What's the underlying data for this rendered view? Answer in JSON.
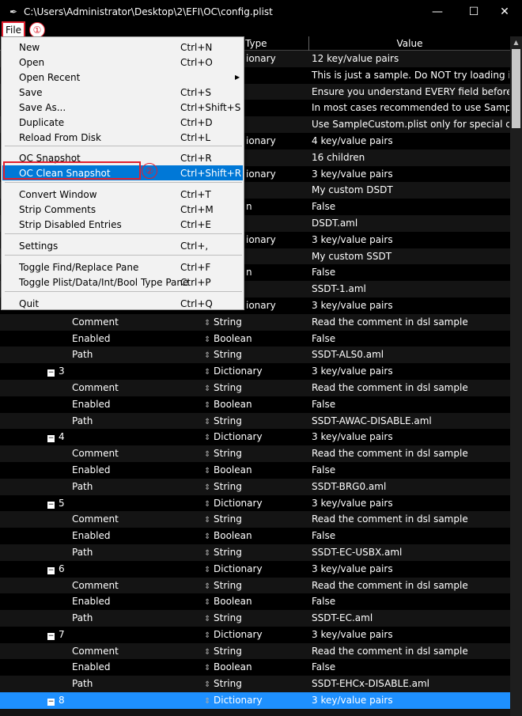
{
  "window": {
    "title": "C:\\Users\\Administrator\\Desktop\\2\\EFI\\OC\\config.plist",
    "minimize_icon": "minimize-icon",
    "maximize_icon": "maximize-icon",
    "close_icon": "close-icon"
  },
  "menubar": {
    "file_label": "File"
  },
  "annotations": {
    "step1": "①",
    "step2": "②",
    "highlight_color": "#e0202e"
  },
  "columns": {
    "type": "Type",
    "value": "Value"
  },
  "menu": {
    "items": [
      {
        "label": "New",
        "shortcut": "Ctrl+N"
      },
      {
        "label": "Open",
        "shortcut": "Ctrl+O"
      },
      {
        "label": "Open Recent",
        "shortcut": "",
        "submenu": true
      },
      {
        "label": "Save",
        "shortcut": "Ctrl+S"
      },
      {
        "label": "Save As...",
        "shortcut": "Ctrl+Shift+S"
      },
      {
        "label": "Duplicate",
        "shortcut": "Ctrl+D"
      },
      {
        "label": "Reload From Disk",
        "shortcut": "Ctrl+L"
      },
      {
        "label": "OC Snapshot",
        "shortcut": "Ctrl+R"
      },
      {
        "label": "OC Clean Snapshot",
        "shortcut": "Ctrl+Shift+R"
      },
      {
        "label": "Convert Window",
        "shortcut": "Ctrl+T"
      },
      {
        "label": "Strip Comments",
        "shortcut": "Ctrl+M"
      },
      {
        "label": "Strip Disabled Entries",
        "shortcut": "Ctrl+E"
      },
      {
        "label": "Settings",
        "shortcut": "Ctrl+,"
      },
      {
        "label": "Toggle Find/Replace Pane",
        "shortcut": "Ctrl+F"
      },
      {
        "label": "Toggle Plist/Data/Int/Bool Type Pane",
        "shortcut": "Ctrl+P"
      },
      {
        "label": "Quit",
        "shortcut": "Ctrl+Q"
      }
    ]
  },
  "rows": [
    {
      "key": "",
      "type": "ionary",
      "value": "12 key/value pairs"
    },
    {
      "key": "",
      "type": "",
      "value": "This is just a sample. Do NOT try loading it."
    },
    {
      "key": "",
      "type": "",
      "value": "Ensure you understand EVERY field before boc"
    },
    {
      "key": "",
      "type": "",
      "value": "In most cases recommended to use Sample.pli"
    },
    {
      "key": "",
      "type": "",
      "value": "Use SampleCustom.plist only for special cases."
    },
    {
      "key": "",
      "type": "ionary",
      "value": "4 key/value pairs"
    },
    {
      "key": "",
      "type": "",
      "value": "16 children"
    },
    {
      "key": "",
      "type": "ionary",
      "value": "3 key/value pairs"
    },
    {
      "key": "",
      "type": "",
      "value": "My custom DSDT"
    },
    {
      "key": "",
      "type": "n",
      "value": "False"
    },
    {
      "key": "",
      "type": "",
      "value": "DSDT.aml"
    },
    {
      "key": "",
      "type": "ionary",
      "value": "3 key/value pairs"
    },
    {
      "key": "",
      "type": "",
      "value": "My custom SSDT"
    },
    {
      "key": "",
      "type": "n",
      "value": "False"
    },
    {
      "key": "",
      "type": "",
      "value": "SSDT-1.aml"
    },
    {
      "key": "",
      "type": "ionary",
      "value": "3 key/value pairs"
    },
    {
      "key": "Comment",
      "type": "String",
      "value": "Read the comment in dsl sample"
    },
    {
      "key": "Enabled",
      "type": "Boolean",
      "value": "False"
    },
    {
      "key": "Path",
      "type": "String",
      "value": "SSDT-ALS0.aml"
    },
    {
      "key": "3",
      "type": "Dictionary",
      "value": "3 key/value pairs",
      "expander": "−"
    },
    {
      "key": "Comment",
      "type": "String",
      "value": "Read the comment in dsl sample"
    },
    {
      "key": "Enabled",
      "type": "Boolean",
      "value": "False"
    },
    {
      "key": "Path",
      "type": "String",
      "value": "SSDT-AWAC-DISABLE.aml"
    },
    {
      "key": "4",
      "type": "Dictionary",
      "value": "3 key/value pairs",
      "expander": "−"
    },
    {
      "key": "Comment",
      "type": "String",
      "value": "Read the comment in dsl sample"
    },
    {
      "key": "Enabled",
      "type": "Boolean",
      "value": "False"
    },
    {
      "key": "Path",
      "type": "String",
      "value": "SSDT-BRG0.aml"
    },
    {
      "key": "5",
      "type": "Dictionary",
      "value": "3 key/value pairs",
      "expander": "−"
    },
    {
      "key": "Comment",
      "type": "String",
      "value": "Read the comment in dsl sample"
    },
    {
      "key": "Enabled",
      "type": "Boolean",
      "value": "False"
    },
    {
      "key": "Path",
      "type": "String",
      "value": "SSDT-EC-USBX.aml"
    },
    {
      "key": "6",
      "type": "Dictionary",
      "value": "3 key/value pairs",
      "expander": "−"
    },
    {
      "key": "Comment",
      "type": "String",
      "value": "Read the comment in dsl sample"
    },
    {
      "key": "Enabled",
      "type": "Boolean",
      "value": "False"
    },
    {
      "key": "Path",
      "type": "String",
      "value": "SSDT-EC.aml"
    },
    {
      "key": "7",
      "type": "Dictionary",
      "value": "3 key/value pairs",
      "expander": "−"
    },
    {
      "key": "Comment",
      "type": "String",
      "value": "Read the comment in dsl sample"
    },
    {
      "key": "Enabled",
      "type": "Boolean",
      "value": "False"
    },
    {
      "key": "Path",
      "type": "String",
      "value": "SSDT-EHCx-DISABLE.aml"
    },
    {
      "key": "8",
      "type": "Dictionary",
      "value": "3 key/value pairs",
      "expander": "−",
      "selected": true
    }
  ],
  "colors": {
    "selection": "#1e90ff",
    "menu_highlight": "#0078d7"
  }
}
